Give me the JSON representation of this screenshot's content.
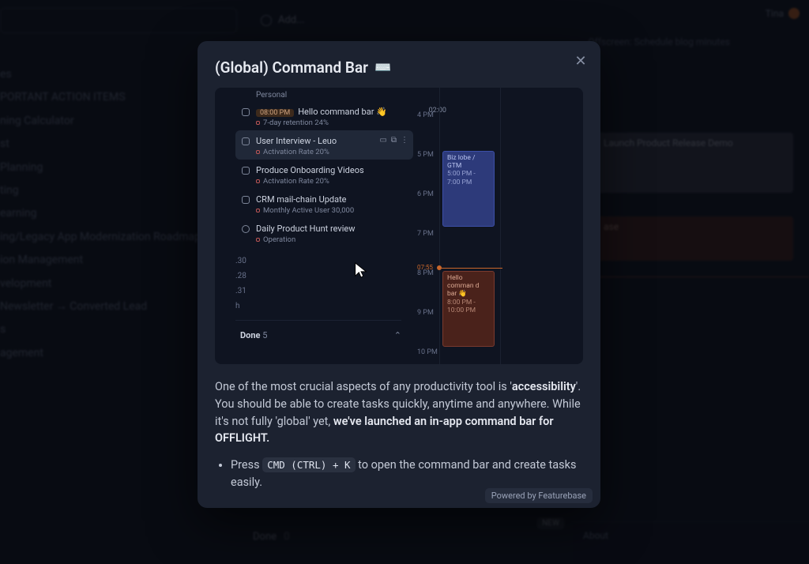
{
  "background": {
    "add_label": "Add...",
    "topright_label": "Tina",
    "subtext": "Offscreen: Schedule blog minutes",
    "sidebar_items": [
      "es",
      "PORTANT ACTION ITEMS",
      "ning Calculator",
      "st",
      "Planning",
      "ting",
      "earning",
      "",
      "ing/Legacy App Modernization Roadmap",
      "ion Management",
      "velopment",
      "Newsletter → Converted Lead",
      "",
      "s",
      "agement"
    ],
    "block1_title": "Launch Product Release Demo",
    "block2_title": "ase",
    "done_label": "Done",
    "done_count": "0",
    "new_badge": "NEW",
    "panel_label": "About"
  },
  "modal": {
    "title": "(Global) Command Bar",
    "emoji": "⌨️",
    "close_glyph": "✕",
    "body_p1a": "One of the most crucial aspects of any productivity tool is '",
    "body_p1b": "accessibility",
    "body_p1c": "'. You should be able to create tasks quickly, anytime and anywhere. While it's not fully 'global' yet, ",
    "body_p1d": "we've launched an in-app command bar for OFFLIGHT.",
    "bullet_pre": "Press ",
    "bullet_code": "CMD (CTRL) + K",
    "bullet_post": " to open the command bar and create tasks easily.",
    "footer": "Powered by Featurebase"
  },
  "preview": {
    "category_header": "Personal",
    "tasks": [
      {
        "title": "Hello command bar 👋",
        "pill": "08:00 PM",
        "sub": "7-day retention 24%",
        "time": "02:00",
        "round": false,
        "selected": false
      },
      {
        "title": "User Interview - Leuo",
        "sub": "Activation Rate 20%",
        "round": false,
        "selected": true
      },
      {
        "title": "Produce Onboarding Videos",
        "sub": "Activation Rate 20%",
        "round": false,
        "selected": false
      },
      {
        "title": "CRM mail-chain Update",
        "sub": "Monthly Active User 30,000",
        "round": false,
        "selected": false
      },
      {
        "title": "Daily Product Hunt review",
        "sub": "Operation",
        "round": true,
        "selected": false
      }
    ],
    "day_labels": [
      ".30",
      ".28",
      ".31",
      "h"
    ],
    "done_label": "Done",
    "done_count": "5",
    "hours": [
      "4 PM",
      "5 PM",
      "6 PM",
      "7 PM",
      "8 PM",
      "9 PM",
      "10 PM"
    ],
    "now_time": "07:55",
    "event_blue": {
      "title": "Biz lobe / GTM",
      "time": "5:00 PM - 7:00 PM"
    },
    "event_red": {
      "title": "Hello comman d bar 👋",
      "time": "8:00 PM - 10:00 PM"
    }
  }
}
